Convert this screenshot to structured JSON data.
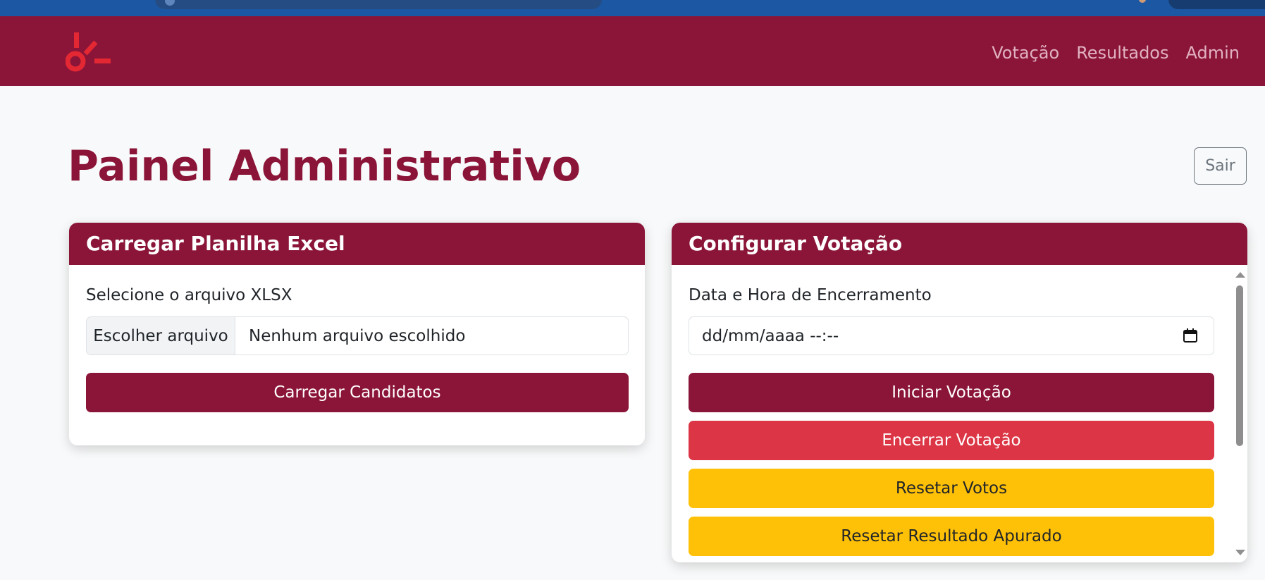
{
  "navbar": {
    "links": [
      "Votação",
      "Resultados",
      "Admin"
    ]
  },
  "page": {
    "title": "Painel Administrativo",
    "logout_label": "Sair"
  },
  "upload_card": {
    "header": "Carregar Planilha Excel",
    "file_label": "Selecione o arquivo XLSX",
    "choose_file_label": "Escolher arquivo",
    "no_file_text": "Nenhum arquivo escolhido",
    "submit_label": "Carregar Candidatos"
  },
  "config_card": {
    "header": "Configurar Votação",
    "end_label": "Data e Hora de Encerramento",
    "datetime_value": "dd/mm/aaaa --:--",
    "start_label": "Iniciar Votação",
    "end_vote_label": "Encerrar Votação",
    "reset_votes_label": "Resetar Votos",
    "reset_result_label": "Resetar Resultado Apurado"
  },
  "colors": {
    "brand": "#8a1538",
    "danger": "#dc3545",
    "warning": "#ffc107",
    "browser_bar": "#1c57a4"
  },
  "icons": [
    "logo-icon",
    "calendar-icon",
    "scroll-up-icon",
    "scroll-down-icon"
  ]
}
